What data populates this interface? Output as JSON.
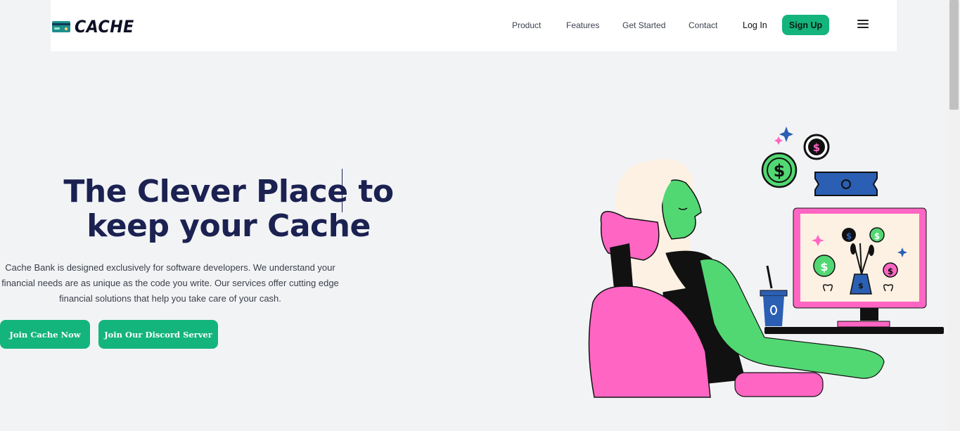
{
  "brand": {
    "name": "CACHE",
    "icon": "credit-card-icon"
  },
  "nav": {
    "links": [
      "Product",
      "Features",
      "Get Started",
      "Contact"
    ],
    "login": "Log In",
    "signup": "Sign Up",
    "menu_icon": "hamburger-menu-icon"
  },
  "hero": {
    "title": "The Clever Place to keep your Cache",
    "description": "Cache Bank is designed exclusively for software developers. We understand your financial needs are as unique as the code you write. Our services offer cutting edge financial solutions that help you take care of your cash.",
    "primary_button": "Join Cache Now",
    "secondary_button": "Join Our Discord Server"
  },
  "colors": {
    "accent": "#14b47d",
    "title": "#1b2151",
    "background": "#f2f3f5",
    "pink": "#ff66c4",
    "green": "#52d873",
    "blue": "#2b5fb3"
  }
}
